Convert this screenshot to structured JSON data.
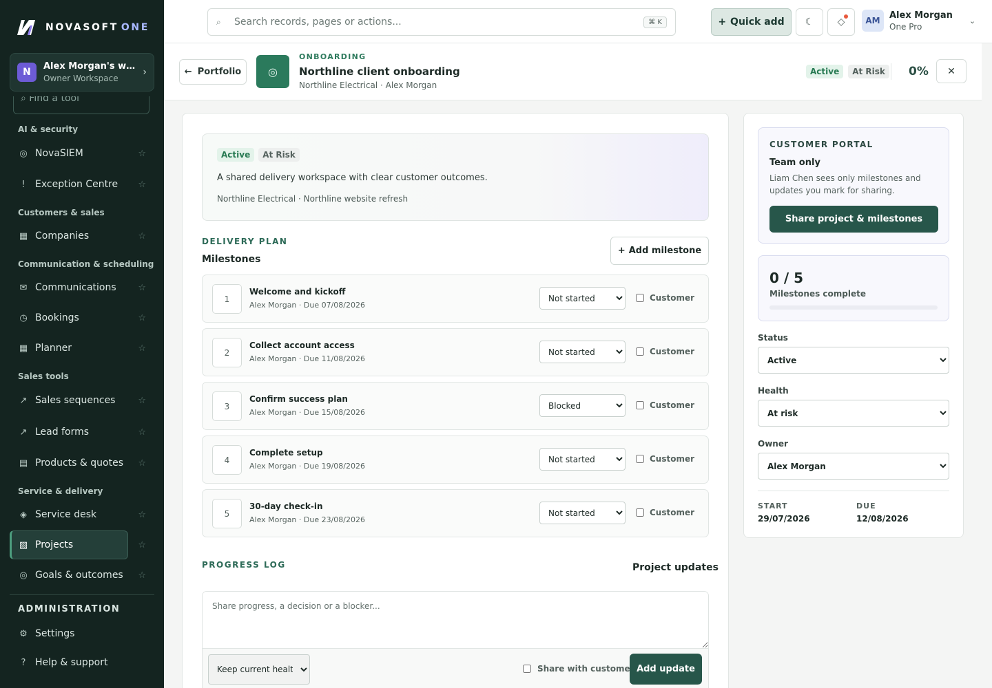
{
  "brand": {
    "name": "NOVASOFT",
    "suffix": "ONE"
  },
  "workspace": {
    "initial": "N",
    "name": "Alex Morgan's workspace",
    "role": "Owner Workspace"
  },
  "sidebar": {
    "find_placeholder": "Find a tool",
    "sections": {
      "ai": "AI & security",
      "customers": "Customers & sales",
      "comms": "Communication & scheduling",
      "sales": "Sales tools",
      "service": "Service & delivery"
    },
    "items": {
      "novasiem": "NovaSIEM",
      "exception": "Exception Centre",
      "companies": "Companies",
      "communications": "Communications",
      "bookings": "Bookings",
      "planner": "Planner",
      "sequences": "Sales sequences",
      "leadforms": "Lead forms",
      "products": "Products & quotes",
      "servicedesk": "Service desk",
      "projects": "Projects",
      "goals": "Goals & outcomes",
      "settings": "Settings",
      "help": "Help & support"
    },
    "admin_heading": "ADMINISTRATION",
    "star_glyph": "☆"
  },
  "topbar": {
    "search_placeholder": "Search records, pages or actions...",
    "shortcut": "⌘ K",
    "quick_add": "Quick add",
    "user": {
      "initials": "AM",
      "name": "Alex Morgan",
      "plan": "One Pro"
    }
  },
  "project": {
    "back_label": "Portfolio",
    "kicker": "ONBOARDING",
    "title": "Northline client onboarding",
    "subtitle": "Northline Electrical · Alex Morgan",
    "status_badge": "Active",
    "health_badge": "At Risk",
    "percent": "0%",
    "close_glyph": "✕"
  },
  "hero": {
    "status_badge": "Active",
    "health_badge": "At Risk",
    "description": "A shared delivery workspace with clear customer outcomes.",
    "meta": "Northline Electrical · Northline website refresh"
  },
  "delivery": {
    "kicker": "DELIVERY PLAN",
    "title": "Milestones",
    "add_label": "Add milestone",
    "customer_label": "Customer",
    "milestones": [
      {
        "num": "1",
        "title": "Welcome and kickoff",
        "meta": "Alex Morgan · Due 07/08/2026",
        "status": "Not started"
      },
      {
        "num": "2",
        "title": "Collect account access",
        "meta": "Alex Morgan · Due 11/08/2026",
        "status": "Not started"
      },
      {
        "num": "3",
        "title": "Confirm success plan",
        "meta": "Alex Morgan · Due 15/08/2026",
        "status": "Blocked"
      },
      {
        "num": "4",
        "title": "Complete setup",
        "meta": "Alex Morgan · Due 19/08/2026",
        "status": "Not started"
      },
      {
        "num": "5",
        "title": "30-day check-in",
        "meta": "Alex Morgan · Due 23/08/2026",
        "status": "Not started"
      }
    ]
  },
  "progress_log": {
    "kicker": "PROGRESS LOG",
    "title": "Project updates",
    "placeholder": "Share progress, a decision or a blocker...",
    "health_option": "Keep current health",
    "share_label": "Share with customer",
    "submit_label": "Add update"
  },
  "portal": {
    "kicker": "CUSTOMER PORTAL",
    "title": "Team only",
    "description": "Liam Chen sees only milestones and updates you mark for sharing.",
    "share_button": "Share project & milestones"
  },
  "progress": {
    "count": "0 / 5",
    "label": "Milestones complete",
    "fraction": 0
  },
  "fields": {
    "status_label": "Status",
    "status_value": "Active",
    "health_label": "Health",
    "health_value": "At risk",
    "owner_label": "Owner",
    "owner_value": "Alex Morgan"
  },
  "dates": {
    "start_label": "START",
    "start_value": "29/07/2026",
    "due_label": "DUE",
    "due_value": "12/08/2026"
  },
  "colors": {
    "sidebar_bg": "#142420",
    "accent": "#27564a",
    "brand_green": "#2b7a5c",
    "active_badge": "#277a52"
  }
}
